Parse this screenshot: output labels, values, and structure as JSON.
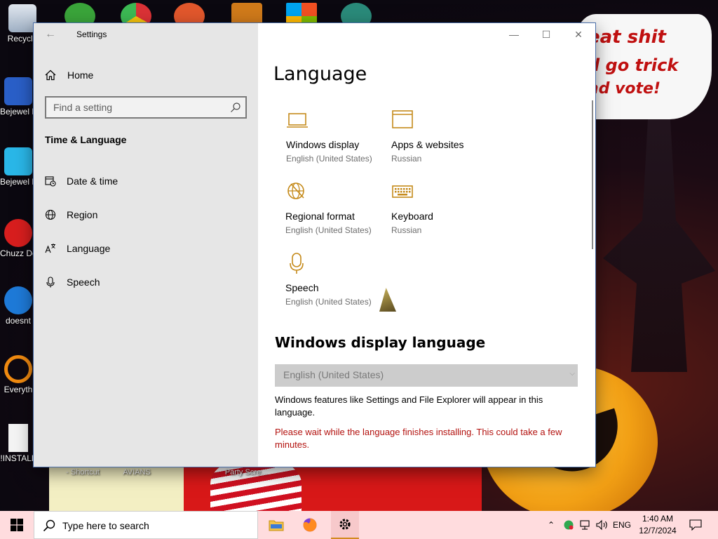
{
  "desktop": {
    "top_text": [
      " eat shit",
      "d go trick",
      "nd vote!"
    ],
    "icons": [
      {
        "label": "Recycle",
        "name": "recycle-bin"
      },
      {
        "label": "Bejewel Delux",
        "name": "bejeweled-shortcut-1"
      },
      {
        "label": "Bejewel Delux",
        "name": "bejeweled-shortcut-2"
      },
      {
        "label": "Chuzz Delux",
        "name": "chuzzle-shortcut"
      },
      {
        "label": "doesnt",
        "name": "doesnt-shortcut"
      },
      {
        "label": "Everyth",
        "name": "everything-shortcut"
      },
      {
        "label": "!INSTALL",
        "name": "install-file"
      }
    ],
    "bottom_labels": [
      "- Shortcut",
      "AVIANS",
      "Party Scre..."
    ]
  },
  "window": {
    "title": "Settings",
    "minimize": "—",
    "maximize": "☐",
    "close": "✕"
  },
  "sidebar": {
    "home": "Home",
    "search_placeholder": "Find a setting",
    "group_title": "Time & Language",
    "items": [
      {
        "label": "Date & time",
        "icon": "calendar-clock-icon"
      },
      {
        "label": "Region",
        "icon": "globe-icon"
      },
      {
        "label": "Language",
        "icon": "language-icon"
      },
      {
        "label": "Speech",
        "icon": "microphone-icon"
      }
    ]
  },
  "content": {
    "title": "Language",
    "tiles": [
      {
        "label": "Windows display",
        "sub": "English (United States)",
        "icon": "laptop-icon"
      },
      {
        "label": "Apps & websites",
        "sub": "Russian",
        "icon": "browser-window-icon"
      },
      {
        "label": "Regional format",
        "sub": "English (United States)",
        "icon": "regional-format-icon"
      },
      {
        "label": "Keyboard",
        "sub": "Russian",
        "icon": "keyboard-icon"
      },
      {
        "label": "Speech",
        "sub": "English (United States)",
        "icon": "microphone-icon"
      }
    ],
    "section_title": "Windows display language",
    "dropdown_value": "English (United States)",
    "description": "Windows features like Settings and File Explorer will appear in this language.",
    "warning": "Please wait while the language finishes installing. This could take a few minutes."
  },
  "taskbar": {
    "search_placeholder": "Type here to search",
    "language": "ENG",
    "time": "1:40 AM",
    "date": "12/7/2024"
  },
  "colors": {
    "accent": "#c58a1a",
    "warning": "#b3120f",
    "taskbar": "#ffdcde"
  }
}
